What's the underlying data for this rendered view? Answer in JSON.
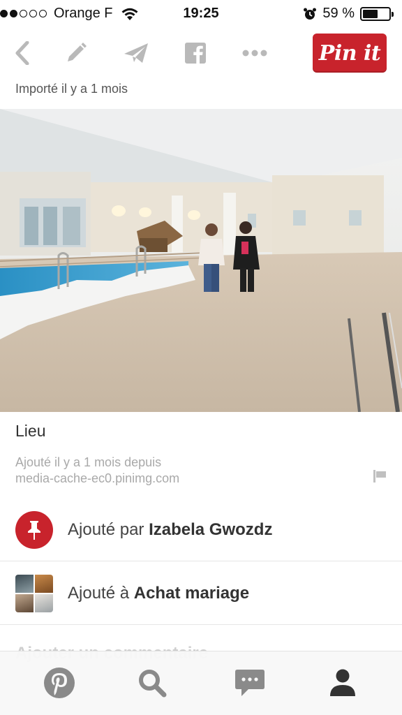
{
  "status_bar": {
    "carrier": "Orange F",
    "time": "19:25",
    "battery": "59 %",
    "battery_level": 0.59
  },
  "toolbar": {
    "pin_label": "Pin it",
    "icons": [
      "back-icon",
      "edit-icon",
      "send-icon",
      "facebook-icon",
      "more-icon"
    ]
  },
  "imported_text": "Importé il y a 1 mois",
  "pin": {
    "title": "Lieu",
    "meta_line1": "Ajouté il y a 1 mois depuis",
    "meta_line2": "media-cache-ec0.pinimg.com"
  },
  "added_by": {
    "prefix": "Ajouté par",
    "user": "Izabela Gwozdz"
  },
  "added_to": {
    "prefix": "Ajouté à",
    "board": "Achat mariage"
  },
  "comment_placeholder": "Ajouter un commentaire",
  "tabbar": {
    "tabs": [
      "pinterest-icon",
      "search-icon",
      "messages-icon",
      "profile-icon"
    ]
  },
  "colors": {
    "brand_red": "#c8232c",
    "icon_gray": "#b9b9b9",
    "tab_gray": "#777777",
    "tab_active": "#333333"
  }
}
